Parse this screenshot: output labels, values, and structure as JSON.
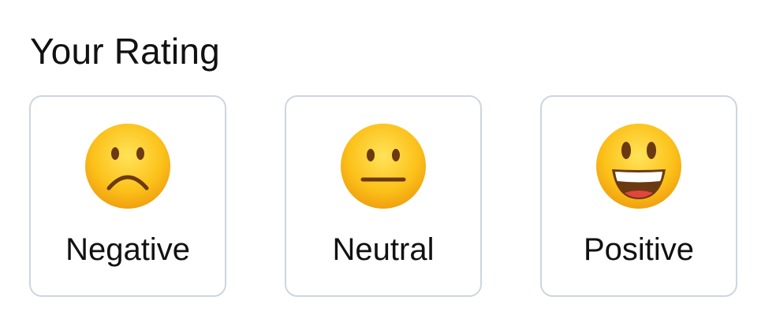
{
  "rating": {
    "title": "Your Rating",
    "options": [
      {
        "label": "Negative",
        "icon": "frowning-face-icon"
      },
      {
        "label": "Neutral",
        "icon": "neutral-face-icon"
      },
      {
        "label": "Positive",
        "icon": "grinning-face-icon"
      }
    ]
  },
  "colors": {
    "card_border": "#cdd5e0",
    "emoji_face": "#f9c21a",
    "emoji_features": "#6b3a12",
    "text": "#111111"
  }
}
